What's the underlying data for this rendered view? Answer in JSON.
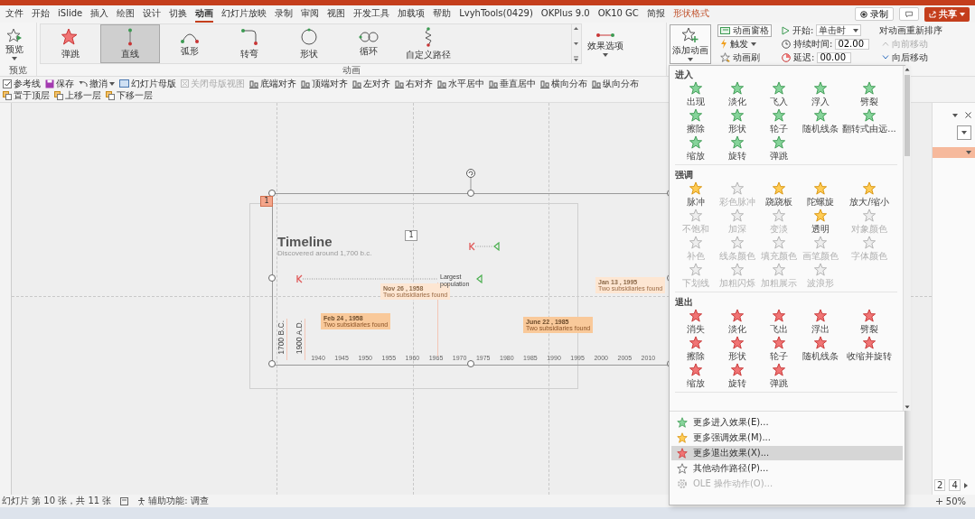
{
  "menu_tabs": [
    {
      "label": "文件",
      "selected": false,
      "kind": "tab"
    },
    {
      "label": "开始",
      "selected": false,
      "kind": "tab"
    },
    {
      "label": "iSlide",
      "selected": false,
      "kind": "tab"
    },
    {
      "label": "插入",
      "selected": false,
      "kind": "tab"
    },
    {
      "label": "绘图",
      "selected": false,
      "kind": "tab"
    },
    {
      "label": "设计",
      "selected": false,
      "kind": "tab"
    },
    {
      "label": "切换",
      "selected": false,
      "kind": "tab"
    },
    {
      "label": "动画",
      "selected": true,
      "kind": "tab"
    },
    {
      "label": "幻灯片放映",
      "selected": false,
      "kind": "tab"
    },
    {
      "label": "录制",
      "selected": false,
      "kind": "tab"
    },
    {
      "label": "审阅",
      "selected": false,
      "kind": "tab"
    },
    {
      "label": "视图",
      "selected": false,
      "kind": "tab"
    },
    {
      "label": "开发工具",
      "selected": false,
      "kind": "tab"
    },
    {
      "label": "加载项",
      "selected": false,
      "kind": "tab"
    },
    {
      "label": "帮助",
      "selected": false,
      "kind": "tab"
    },
    {
      "label": "LvyhTools(0429)",
      "selected": false,
      "kind": "tab"
    },
    {
      "label": "OKPlus 9.0",
      "selected": false,
      "kind": "tab"
    },
    {
      "label": "OK10 GC",
      "selected": false,
      "kind": "tab"
    },
    {
      "label": "简报",
      "selected": false,
      "kind": "tab"
    },
    {
      "label": "形状格式",
      "selected": false,
      "kind": "contextual"
    }
  ],
  "record_button": "录制",
  "share_button": "共享",
  "ribbon": {
    "preview_button": "预览",
    "preview_group": "预览",
    "animations": [
      {
        "label": "弹跳",
        "selected": false,
        "kind": "bounce"
      },
      {
        "label": "直线",
        "selected": true,
        "kind": "line"
      },
      {
        "label": "弧形",
        "selected": false,
        "kind": "arc"
      },
      {
        "label": "转弯",
        "selected": false,
        "kind": "turn"
      },
      {
        "label": "形状",
        "selected": false,
        "kind": "circle"
      },
      {
        "label": "循环",
        "selected": false,
        "kind": "loop"
      },
      {
        "label": "自定义路径",
        "selected": false,
        "kind": "custom"
      }
    ],
    "effect_options": "效果选项",
    "animations_group": "动画",
    "add_animation": "添加动画",
    "pane_buttons": [
      {
        "label": "动画窗格",
        "kind": "pane"
      },
      {
        "label": "触发",
        "kind": "trigger"
      },
      {
        "label": "动画刷",
        "kind": "painter"
      }
    ],
    "timing": {
      "start_label": "开始:",
      "start_value": "单击时",
      "duration_label": "持续时间:",
      "duration_value": "02.00",
      "delay_label": "延迟:",
      "delay_value": "00.00"
    },
    "reorder": {
      "title": "对动画重新排序",
      "items": [
        {
          "label": "向前移动",
          "disabled": true
        },
        {
          "label": "向后移动",
          "disabled": false
        }
      ]
    }
  },
  "quick_toolbar": [
    {
      "label": "参考线",
      "kind": "checkbox",
      "checked": true,
      "disabled": false
    },
    {
      "label": "保存",
      "kind": "save",
      "disabled": false
    },
    {
      "label": "撤消",
      "kind": "undo",
      "disabled": false
    },
    {
      "label": "幻灯片母版",
      "kind": "master",
      "disabled": false
    },
    {
      "label": "关闭母版视图",
      "kind": "close",
      "disabled": true
    },
    {
      "label": "底端对齐",
      "kind": "align",
      "disabled": false
    },
    {
      "label": "顶端对齐",
      "kind": "align",
      "disabled": false
    },
    {
      "label": "左对齐",
      "kind": "align",
      "disabled": false
    },
    {
      "label": "右对齐",
      "kind": "align",
      "disabled": false
    },
    {
      "label": "水平居中",
      "kind": "align",
      "disabled": false
    },
    {
      "label": "垂直居中",
      "kind": "align",
      "disabled": false
    },
    {
      "label": "横向分布",
      "kind": "align",
      "disabled": false
    },
    {
      "label": "纵向分布",
      "kind": "align",
      "disabled": false
    },
    {
      "label": "置于顶层",
      "kind": "layer",
      "disabled": false
    },
    {
      "label": "上移一层",
      "kind": "layer",
      "disabled": false
    },
    {
      "label": "下移一层",
      "kind": "layer",
      "disabled": false
    }
  ],
  "slide": {
    "tag": "1",
    "number": "1",
    "title": "Timeline",
    "subtitle": "Discovered around 1,700 b.c.",
    "eras": [
      "1700 B.C.",
      "1900 A.D."
    ],
    "years": [
      "1940",
      "1945",
      "1950",
      "1955",
      "1960",
      "1965",
      "1970",
      "1975",
      "1980",
      "1985",
      "1990",
      "1995",
      "2000",
      "2005",
      "2010"
    ],
    "callouts": [
      {
        "date": "Feb 24 , 1958",
        "note": "Two subsidiaries found",
        "faded": false
      },
      {
        "date": "Nov 26 , 1958",
        "note": "Two subsidiaries found",
        "faded": true
      },
      {
        "date": "June 22 , 1985",
        "note": "Two subsidiaries found",
        "faded": false
      },
      {
        "date": "Jan 13 , 1995",
        "note": "Two subsidiaries found",
        "faded": true
      }
    ],
    "annotation": "Largest population"
  },
  "effects_menu": {
    "sections": [
      {
        "title": "进入",
        "kind": "entrance",
        "items": [
          {
            "label": "出现",
            "disabled": false
          },
          {
            "label": "淡化",
            "disabled": false
          },
          {
            "label": "飞入",
            "disabled": false
          },
          {
            "label": "浮入",
            "disabled": false
          },
          {
            "label": "劈裂",
            "disabled": false
          },
          {
            "label": "擦除",
            "disabled": false
          },
          {
            "label": "形状",
            "disabled": false
          },
          {
            "label": "轮子",
            "disabled": false
          },
          {
            "label": "随机线条",
            "disabled": false
          },
          {
            "label": "翻转式由远...",
            "disabled": false
          },
          {
            "label": "缩放",
            "disabled": false
          },
          {
            "label": "旋转",
            "disabled": false
          },
          {
            "label": "弹跳",
            "disabled": false
          }
        ]
      },
      {
        "title": "强调",
        "kind": "emphasis",
        "items": [
          {
            "label": "脉冲",
            "disabled": false
          },
          {
            "label": "彩色脉冲",
            "disabled": true
          },
          {
            "label": "跷跷板",
            "disabled": false
          },
          {
            "label": "陀螺旋",
            "disabled": false
          },
          {
            "label": "放大/缩小",
            "disabled": false
          },
          {
            "label": "不饱和",
            "disabled": true
          },
          {
            "label": "加深",
            "disabled": true
          },
          {
            "label": "变淡",
            "disabled": true
          },
          {
            "label": "透明",
            "disabled": false
          },
          {
            "label": "对象颜色",
            "disabled": true
          },
          {
            "label": "补色",
            "disabled": true
          },
          {
            "label": "线条颜色",
            "disabled": true
          },
          {
            "label": "填充颜色",
            "disabled": true
          },
          {
            "label": "画笔颜色",
            "disabled": true
          },
          {
            "label": "字体颜色",
            "disabled": true
          },
          {
            "label": "下划线",
            "disabled": true
          },
          {
            "label": "加粗闪烁",
            "disabled": true
          },
          {
            "label": "加粗展示",
            "disabled": true
          },
          {
            "label": "波浪形",
            "disabled": true
          }
        ]
      },
      {
        "title": "退出",
        "kind": "exit",
        "items": [
          {
            "label": "消失",
            "disabled": false
          },
          {
            "label": "淡化",
            "disabled": false
          },
          {
            "label": "飞出",
            "disabled": false
          },
          {
            "label": "浮出",
            "disabled": false
          },
          {
            "label": "劈裂",
            "disabled": false
          },
          {
            "label": "擦除",
            "disabled": false
          },
          {
            "label": "形状",
            "disabled": false
          },
          {
            "label": "轮子",
            "disabled": false
          },
          {
            "label": "随机线条",
            "disabled": false
          },
          {
            "label": "收缩并旋转",
            "disabled": false
          },
          {
            "label": "缩放",
            "disabled": false
          },
          {
            "label": "旋转",
            "disabled": false
          },
          {
            "label": "弹跳",
            "disabled": false
          }
        ]
      }
    ],
    "more": [
      {
        "label": "更多进入效果(E)...",
        "kind": "entrance",
        "selected": false,
        "disabled": false
      },
      {
        "label": "更多强调效果(M)...",
        "kind": "emphasis",
        "selected": false,
        "disabled": false
      },
      {
        "label": "更多退出效果(X)...",
        "kind": "exit",
        "selected": true,
        "disabled": false
      },
      {
        "label": "其他动作路径(P)...",
        "kind": "path",
        "selected": false,
        "disabled": false
      },
      {
        "label": "OLE 操作动作(O)...",
        "kind": "ole",
        "selected": false,
        "disabled": true
      }
    ]
  },
  "right_pane": {
    "pager_from": "2",
    "pager_to": "4"
  },
  "status_bar": {
    "slide_info": "幻灯片 第 10 张，共 11 张",
    "accessibility": "辅助功能: 调查",
    "zoom": "50%"
  }
}
